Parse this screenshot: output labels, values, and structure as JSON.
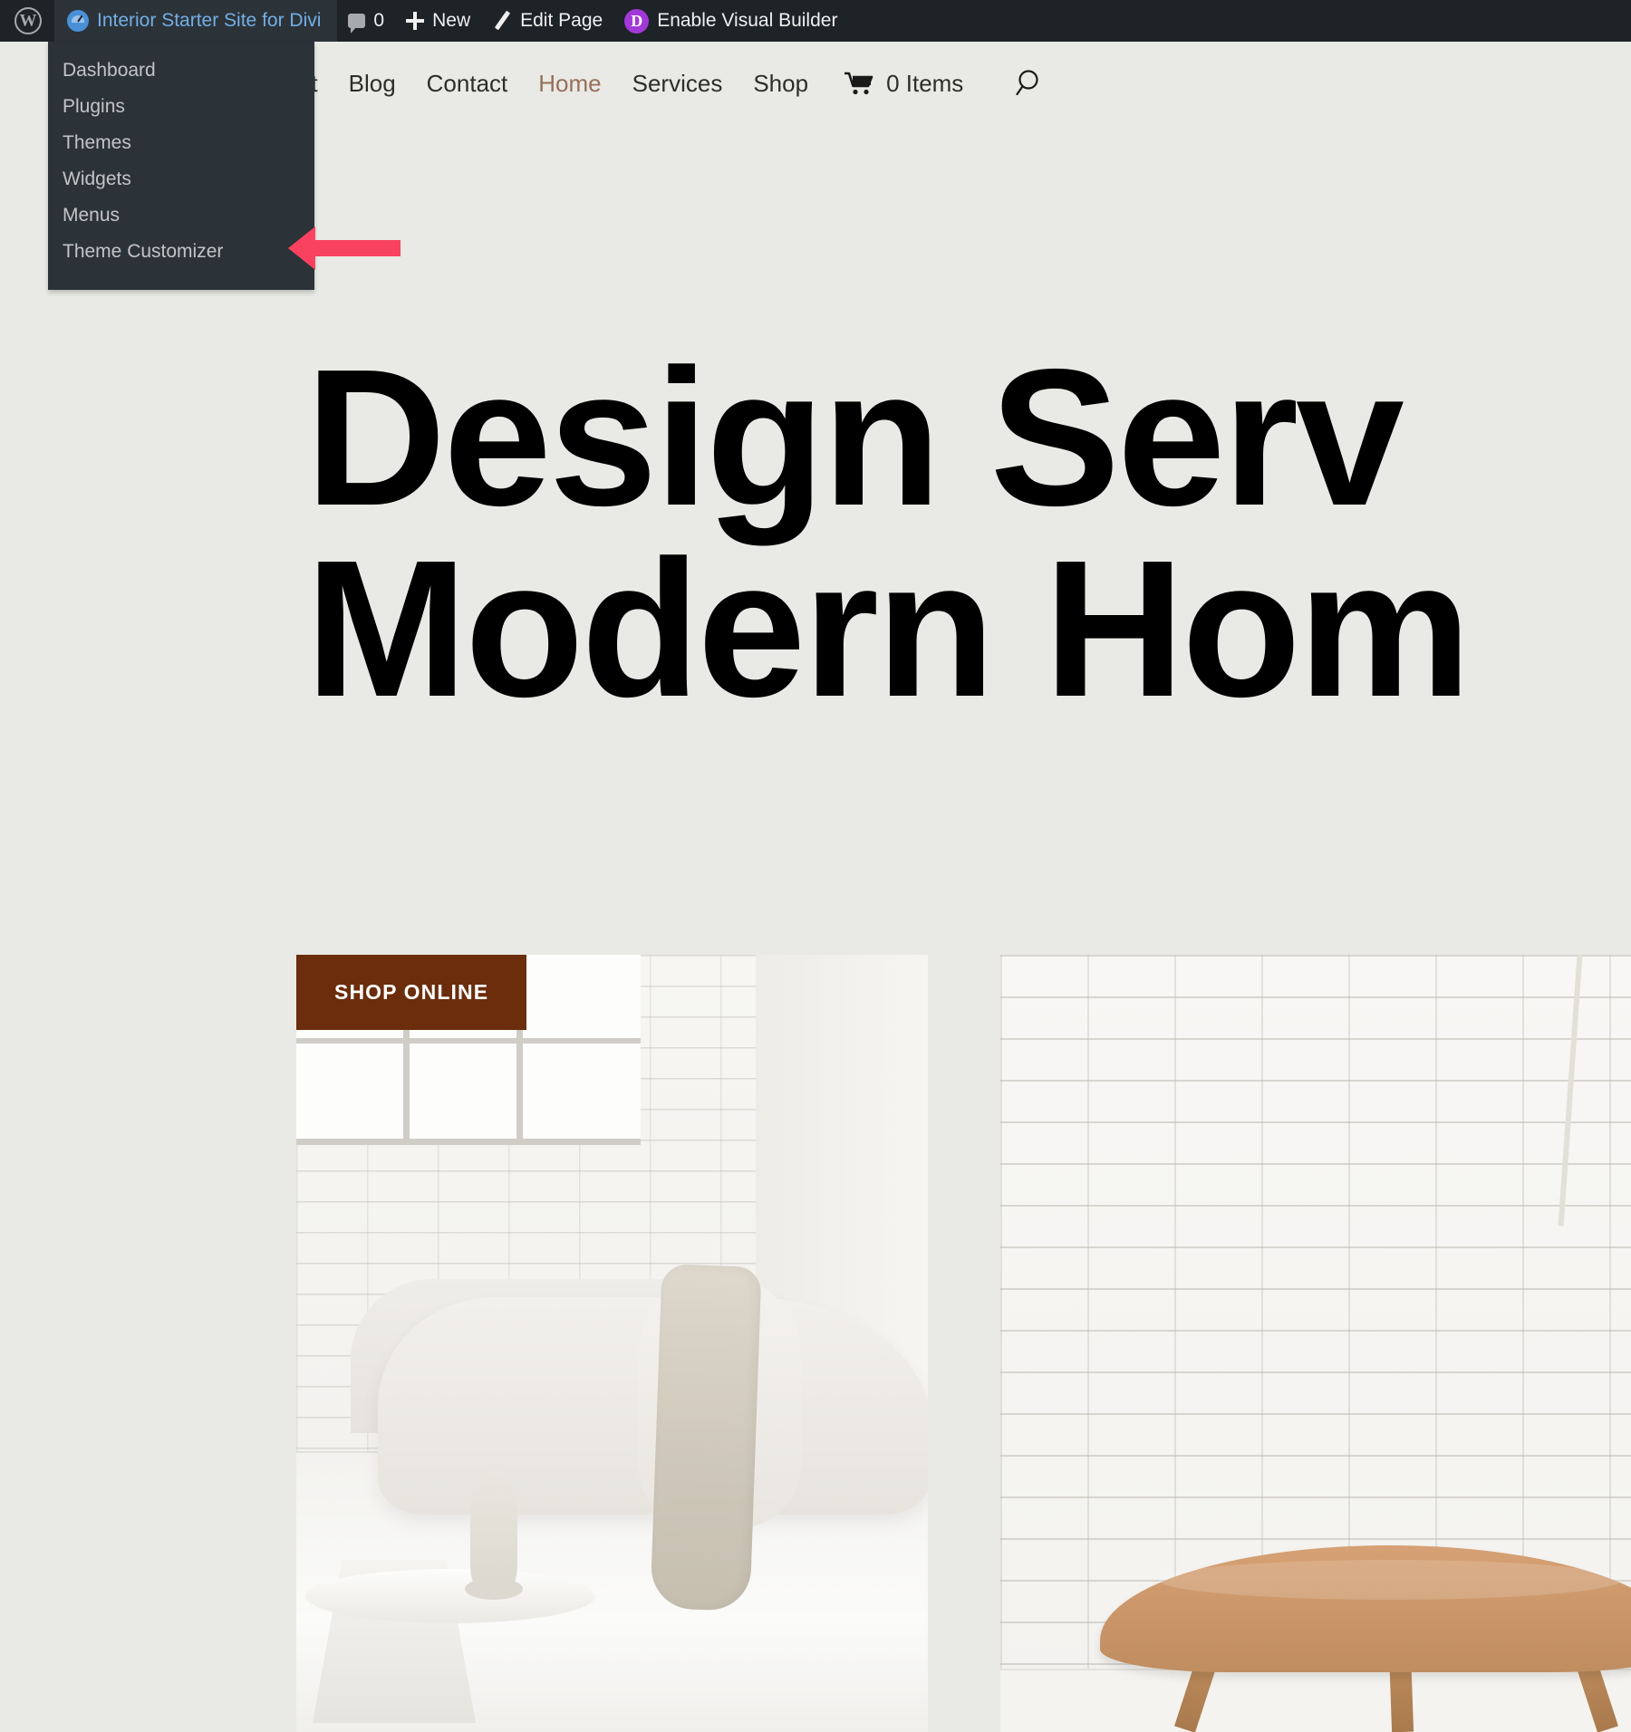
{
  "adminbar": {
    "wp_logo_icon": "wordpress-logo-icon",
    "site_name": "Interior Starter Site for Divi",
    "site_icon": "divi-dashboard-icon",
    "comments_icon": "comment-bubble-icon",
    "comments_count": "0",
    "new_icon": "plus-icon",
    "new_label": "New",
    "edit_icon": "pencil-icon",
    "edit_label": "Edit Page",
    "divi_badge": "D",
    "visual_builder_label": "Enable Visual Builder",
    "bg_color": "#1d2327",
    "site_name_bg": "#2c3338",
    "site_name_color": "#72aee6",
    "divi_badge_color": "#a238d8"
  },
  "dropdown": {
    "bg_color": "#2c3338",
    "text_color": "#c3c4c7",
    "items": [
      {
        "label": "Dashboard"
      },
      {
        "label": "Plugins"
      },
      {
        "label": "Themes"
      },
      {
        "label": "Widgets"
      },
      {
        "label": "Menus"
      },
      {
        "label": "Theme Customizer"
      }
    ]
  },
  "annotation": {
    "arrow_color": "#f8425f",
    "arrow_direction": "left",
    "points_at": "Theme Customizer"
  },
  "site_nav": {
    "items": [
      {
        "label": "bout",
        "active": false
      },
      {
        "label": "Blog",
        "active": false
      },
      {
        "label": "Contact",
        "active": false
      },
      {
        "label": "Home",
        "active": true
      },
      {
        "label": "Services",
        "active": false
      },
      {
        "label": "Shop",
        "active": false
      }
    ],
    "cart_icon": "shopping-cart-icon",
    "cart_label": "0 Items",
    "search_icon": "search-icon",
    "active_color": "#96705c",
    "text_color": "#2d2d2d"
  },
  "hero": {
    "line1": "Design Serv",
    "line2": "Modern Hom",
    "color": "#000000",
    "background": "#e9e9e5"
  },
  "gallery": {
    "badge_label": "SHOP ONLINE",
    "badge_color": "#6b2d0c",
    "badge_text_color": "#ffffff",
    "left_image_alt": "white minimalist living room with curved sofa, marble coffee table and linen throw",
    "right_image_alt": "tan leather butterfly chair against a white painted brick wall"
  }
}
